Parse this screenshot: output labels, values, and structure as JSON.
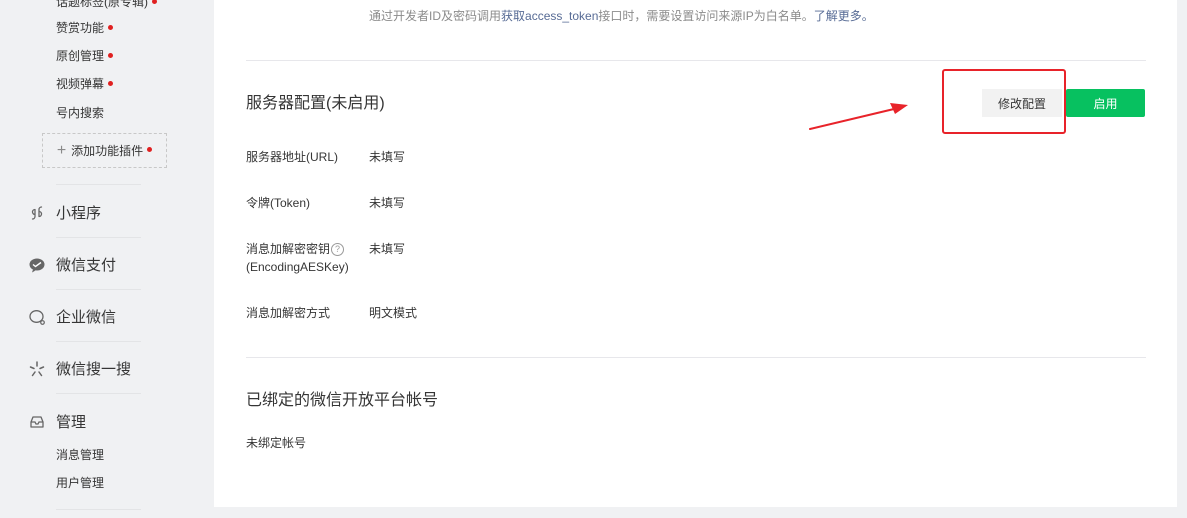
{
  "sidebar": {
    "plugin_items": [
      {
        "label": "话题标签(原专辑)",
        "dot": true
      },
      {
        "label": "赞赏功能",
        "dot": true
      },
      {
        "label": "原创管理",
        "dot": true
      },
      {
        "label": "视频弹幕",
        "dot": true
      },
      {
        "label": "号内搜索",
        "dot": false
      }
    ],
    "add_plugin": "添加功能插件",
    "sections": [
      {
        "label": "小程序",
        "icon": "mini-program-icon"
      },
      {
        "label": "微信支付",
        "icon": "wechat-pay-icon"
      },
      {
        "label": "企业微信",
        "icon": "work-wechat-icon"
      },
      {
        "label": "微信搜一搜",
        "icon": "wechat-search-icon"
      },
      {
        "label": "管理",
        "icon": "management-icon"
      }
    ],
    "management_items": [
      "消息管理",
      "用户管理"
    ]
  },
  "main": {
    "notice_prefix": "通过开发者ID及密码调用",
    "notice_link": "获取access_token",
    "notice_middle": "接口时，需要设置访问来源IP为白名单。",
    "notice_more": "了解更多。",
    "server_title": "服务器配置(未启用)",
    "modify_button": "修改配置",
    "enable_button": "启用",
    "rows": [
      {
        "label": "服务器地址(URL)",
        "value": "未填写"
      },
      {
        "label": "令牌(Token)",
        "value": "未填写"
      },
      {
        "label": "消息加解密密钥",
        "label2": "(EncodingAESKey)",
        "value": "未填写"
      },
      {
        "label": "消息加解密方式",
        "value": "明文模式"
      }
    ],
    "bound_title": "已绑定的微信开放平台帐号",
    "bound_value": "未绑定帐号"
  },
  "colors": {
    "accent_green": "#07c160",
    "link_blue": "#576b95",
    "annotation_red": "#e8232a",
    "dot_red": "#e02020"
  }
}
